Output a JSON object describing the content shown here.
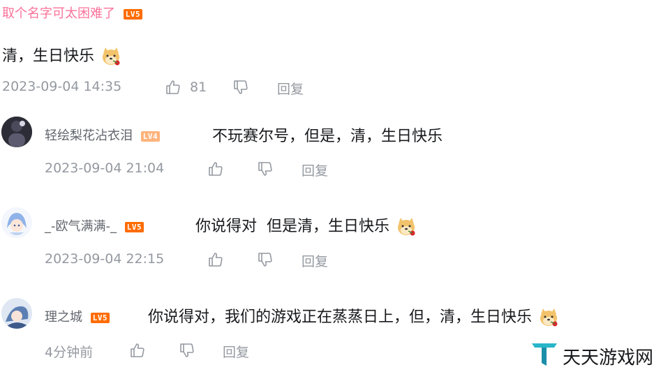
{
  "colors": {
    "lv5": "#ff6c00",
    "lv4": "#ffb37c",
    "pink": "#fb7299",
    "meta": "#9499a0"
  },
  "main_comment": {
    "username": "取个名字可太困难了",
    "level": "LV5",
    "text": "清，生日快乐",
    "emoji": "doge-rose-emoji",
    "time": "2023-09-04 14:35",
    "likes": "81",
    "reply_label": "回复"
  },
  "replies": [
    {
      "username": "轻绘梨花沾衣泪",
      "level": "LV4",
      "text": "不玩赛尔号，但是，清，生日快乐",
      "time": "2023-09-04 21:04",
      "reply_label": "回复"
    },
    {
      "username": "_-欧气满满-_",
      "level": "LV5",
      "text": "你说得对  但是清，生日快乐",
      "time": "2023-09-04 22:15",
      "reply_label": "回复"
    },
    {
      "username": "理之城",
      "level": "LV5",
      "text": "你说得对，我们的游戏正在蒸蒸日上，但，清，生日快乐",
      "time": "4分钟前",
      "reply_label": "回复"
    }
  ],
  "watermark": {
    "text": "天天游戏网"
  }
}
